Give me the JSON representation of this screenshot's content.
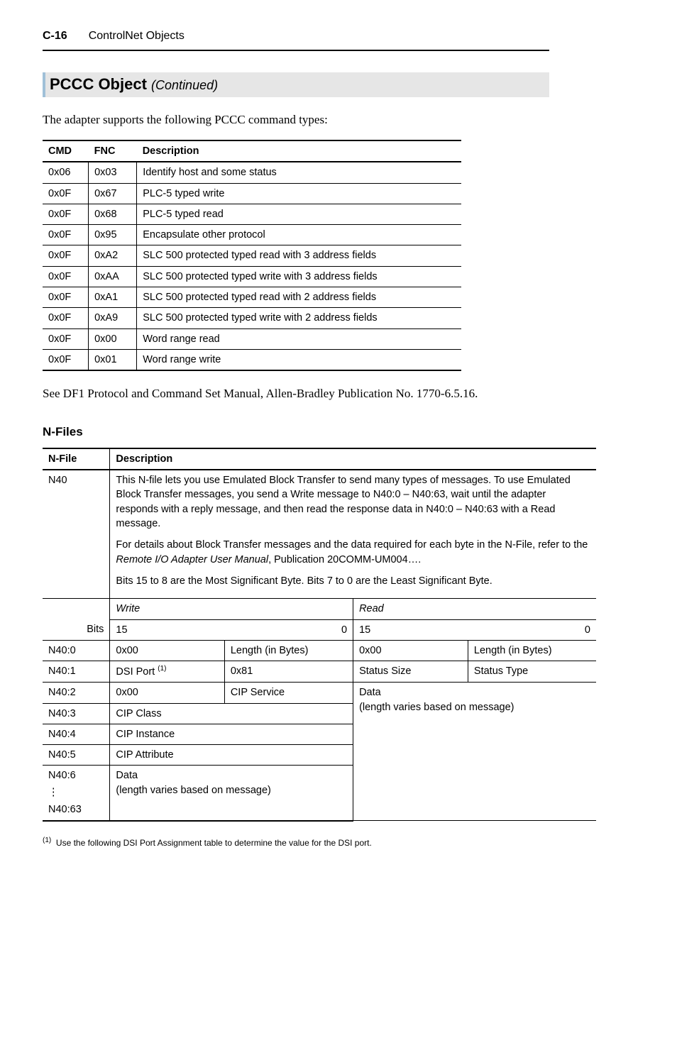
{
  "header": {
    "page_num": "C-16",
    "title": "ControlNet Objects"
  },
  "section_heading": "PCCC Object",
  "continued": "(Continued)",
  "intro_text": "The adapter supports the following PCCC command types:",
  "cmd_table": {
    "headers": [
      "CMD",
      "FNC",
      "Description"
    ],
    "rows": [
      [
        "0x06",
        "0x03",
        "Identify host and some status"
      ],
      [
        "0x0F",
        "0x67",
        "PLC-5 typed write"
      ],
      [
        "0x0F",
        "0x68",
        "PLC-5 typed read"
      ],
      [
        "0x0F",
        "0x95",
        "Encapsulate other protocol"
      ],
      [
        "0x0F",
        "0xA2",
        "SLC 500 protected typed read with 3 address fields"
      ],
      [
        "0x0F",
        "0xAA",
        "SLC 500 protected typed write with 3 address fields"
      ],
      [
        "0x0F",
        "0xA1",
        "SLC 500 protected typed read with 2 address fields"
      ],
      [
        "0x0F",
        "0xA9",
        "SLC 500 protected typed write with 2 address fields"
      ],
      [
        "0x0F",
        "0x00",
        "Word range read"
      ],
      [
        "0x0F",
        "0x01",
        "Word range write"
      ]
    ]
  },
  "post_table_text": "See DF1 Protocol and Command Set Manual, Allen-Bradley Publication No. 1770-6.5.16.",
  "nfiles_heading": "N-Files",
  "nfile_header_col1": "N-File",
  "nfile_header_col2": "Description",
  "nfile_label": "N40",
  "nfile_desc_p1": "This N-file lets you use Emulated Block Transfer to send many types of messages. To use Emulated Block Transfer messages, you send a Write message to N40:0 – N40:63, wait until the adapter responds with a reply message, and then read the response data in N40:0 – N40:63 with a Read message.",
  "nfile_desc_p2_a": "For details about Block Transfer messages and the data required for each byte in the N-File, refer to the ",
  "nfile_desc_p2_i": "Remote I/O Adapter User Manual",
  "nfile_desc_p2_b": ", Publication 20COMM-UM004….",
  "nfile_desc_p3": "Bits 15 to 8 are the Most Significant Byte. Bits 7 to 0 are the Least Significant Byte.",
  "wr_write": "Write",
  "wr_read": "Read",
  "bits_label": "Bits",
  "bits_15": "15",
  "bits_0": "0",
  "row_labels": {
    "r0": "N40:0",
    "r1": "N40:1",
    "r2": "N40:2",
    "r3": "N40:3",
    "r4": "N40:4",
    "r5": "N40:5",
    "r6": "N40:6",
    "r63": "N40:63"
  },
  "cells": {
    "c00a": "0x00",
    "c00b": "Length (in Bytes)",
    "c00c": "0x00",
    "c00d": "Length (in Bytes)",
    "c01a": "DSI Port",
    "c01a_sup": "(1)",
    "c01b": "0x81",
    "c01c": "Status Size",
    "c01d": "Status Type",
    "c02a": "0x00",
    "c02b": "CIP Service",
    "c02cd": "Data\n(length varies based on message)",
    "c03": "CIP Class",
    "c04": "CIP Instance",
    "c05": "CIP Attribute",
    "c06": "Data\n(length varies based on message)"
  },
  "vdots": "⋮",
  "footnote_marker": "(1)",
  "footnote_text": "Use the following DSI Port Assignment table to determine the value for the DSI port."
}
